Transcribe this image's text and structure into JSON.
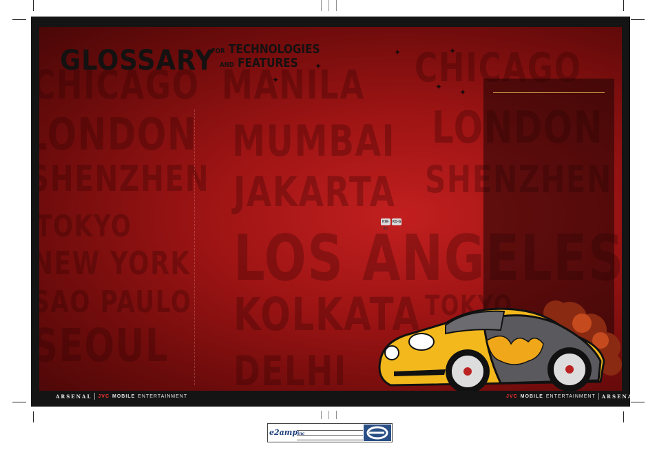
{
  "title": {
    "main": "GLOSSARY",
    "for": "FOR",
    "technologies": "TECHNOLOGIES",
    "and": "AND",
    "features": "FEATURES"
  },
  "background_cities": [
    {
      "text": "CHICAGO"
    },
    {
      "text": "MANILA"
    },
    {
      "text": "CHICAGO"
    },
    {
      "text": "LONDON"
    },
    {
      "text": "MUMBAI"
    },
    {
      "text": "LONDON"
    },
    {
      "text": "SHENZHEN"
    },
    {
      "text": "JAKARTA"
    },
    {
      "text": "SHENZHEN"
    },
    {
      "text": "TOKYO"
    },
    {
      "text": "NEW YORK"
    },
    {
      "text": "LOS ANGELES"
    },
    {
      "text": "SAO PAULO"
    },
    {
      "text": "KOLKATA"
    },
    {
      "text": "TOKYO"
    },
    {
      "text": "SEOUL"
    },
    {
      "text": "DELHI"
    }
  ],
  "badges": [
    "KW-XC",
    "KD-G"
  ],
  "footer_left": {
    "brand": "ARSENAL",
    "jvc": "JVC",
    "mobile": "MOBILE",
    "ent": "ENTERTAINMENT"
  },
  "footer_right": {
    "brand": "ARSENAL",
    "jvc": "JVC",
    "mobile": "MOBILE",
    "ent": "ENTERTAINMENT"
  },
  "stamp": {
    "logo": "e2amp",
    "inc": "inc"
  },
  "colors": {
    "panel_red": "#9e1414",
    "background": "#141414",
    "car_body": "#f2b81c",
    "rule_gold": "#c9a04a",
    "jvc_red": "#ff3333"
  }
}
